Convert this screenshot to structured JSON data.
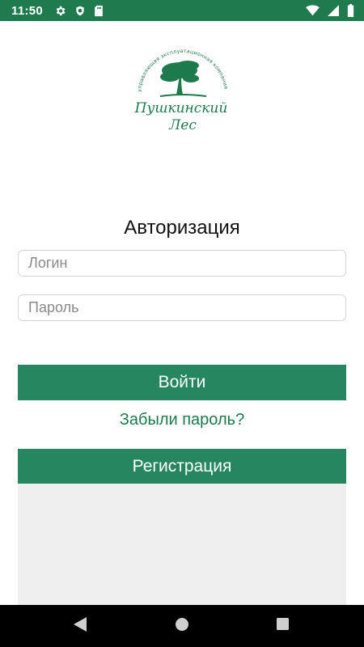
{
  "status_bar": {
    "time": "11:50",
    "left_icons": [
      "gear-icon",
      "shield-icon",
      "sd-card-icon"
    ],
    "right_icons": [
      "wifi-icon",
      "signal-icon",
      "battery-icon"
    ],
    "background_color": "#1f7a4d"
  },
  "logo": {
    "arc_text": "управляющая эксплуатационная компания",
    "name_line1": "Пушкинский",
    "name_line2": "Лес",
    "icon": "tree-icon",
    "color": "#1d7a4c"
  },
  "auth": {
    "title": "Авторизация",
    "login_placeholder": "Логин",
    "login_value": "",
    "password_placeholder": "Пароль",
    "password_value": "",
    "login_button_label": "Войти",
    "forgot_password_label": "Забыли пароль?",
    "register_button_label": "Регистрация",
    "accent_color": "#268660"
  },
  "nav_bar": {
    "back_icon": "back-triangle-icon",
    "home_icon": "home-circle-icon",
    "recents_icon": "recents-square-icon"
  }
}
